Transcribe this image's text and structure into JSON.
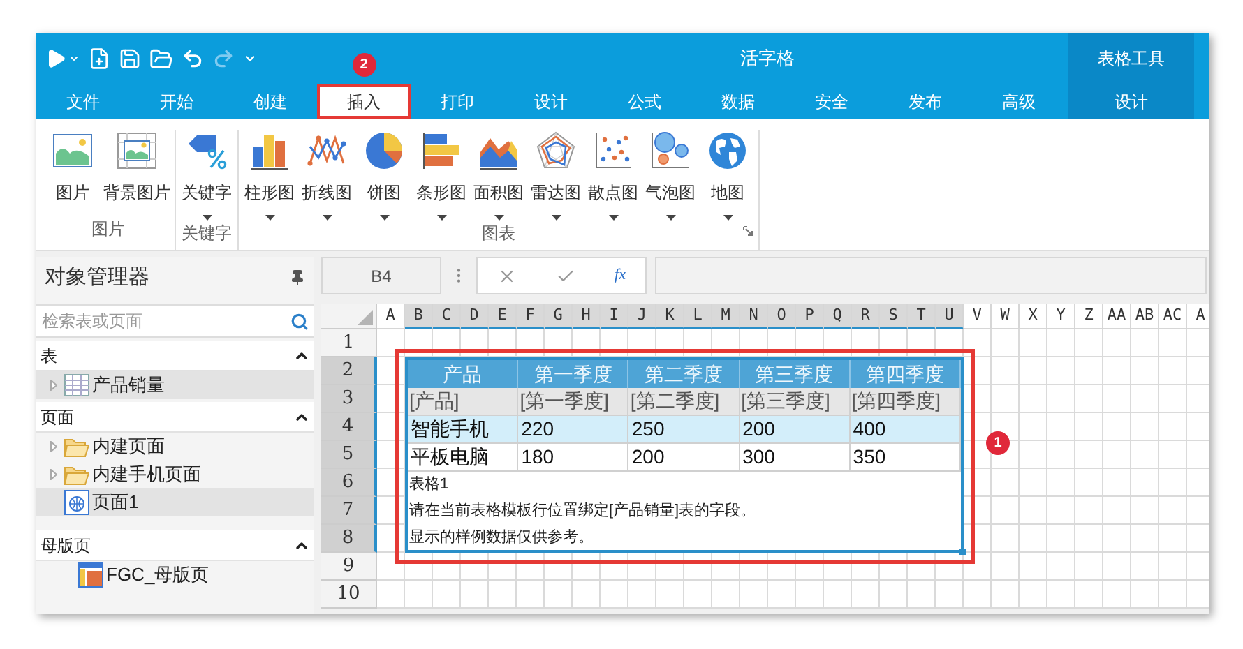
{
  "window": {
    "title": "活字格",
    "context_group": "表格工具"
  },
  "tabs": [
    {
      "label": "文件",
      "selected": false,
      "kind": "main"
    },
    {
      "label": "开始",
      "selected": false,
      "kind": "main"
    },
    {
      "label": "创建",
      "selected": false,
      "kind": "main"
    },
    {
      "label": "插入",
      "selected": true,
      "kind": "main"
    },
    {
      "label": "打印",
      "selected": false,
      "kind": "main"
    },
    {
      "label": "设计",
      "selected": false,
      "kind": "main"
    },
    {
      "label": "公式",
      "selected": false,
      "kind": "main"
    },
    {
      "label": "数据",
      "selected": false,
      "kind": "main"
    },
    {
      "label": "安全",
      "selected": false,
      "kind": "main"
    },
    {
      "label": "发布",
      "selected": false,
      "kind": "main"
    },
    {
      "label": "高级",
      "selected": false,
      "kind": "main"
    },
    {
      "label": "设计",
      "selected": false,
      "kind": "context"
    }
  ],
  "annotations": {
    "tab_marker": "2",
    "table_marker": "1"
  },
  "ribbon": {
    "groups": [
      {
        "label": "图片",
        "launcher": false,
        "buttons": [
          {
            "label": "图片",
            "kind": "picture",
            "dropdown": false
          },
          {
            "label": "背景图片",
            "kind": "background",
            "dropdown": false
          }
        ]
      },
      {
        "label": "关键字",
        "launcher": false,
        "buttons": [
          {
            "label": "关键字",
            "kind": "keyword",
            "dropdown": true
          }
        ]
      },
      {
        "label": "图表",
        "launcher": true,
        "buttons": [
          {
            "label": "柱形图",
            "kind": "column",
            "dropdown": true
          },
          {
            "label": "折线图",
            "kind": "line",
            "dropdown": true
          },
          {
            "label": "饼图",
            "kind": "pie",
            "dropdown": true
          },
          {
            "label": "条形图",
            "kind": "bar",
            "dropdown": true
          },
          {
            "label": "面积图",
            "kind": "area",
            "dropdown": true
          },
          {
            "label": "雷达图",
            "kind": "radar",
            "dropdown": true
          },
          {
            "label": "散点图",
            "kind": "scatter",
            "dropdown": true
          },
          {
            "label": "气泡图",
            "kind": "bubble",
            "dropdown": true
          },
          {
            "label": "地图",
            "kind": "map",
            "dropdown": true
          }
        ]
      }
    ]
  },
  "sidebar": {
    "title": "对象管理器",
    "search": {
      "placeholder": "检索表或页面"
    },
    "sections": [
      {
        "title": "表",
        "expanded": true,
        "items": [
          {
            "label": "产品销量",
            "kind": "table",
            "expandable": true,
            "selected": true
          }
        ]
      },
      {
        "title": "页面",
        "expanded": true,
        "items": [
          {
            "label": "内建页面",
            "kind": "folder",
            "expandable": true,
            "selected": false
          },
          {
            "label": "内建手机页面",
            "kind": "folder",
            "expandable": true,
            "selected": false
          },
          {
            "label": "页面1",
            "kind": "page",
            "expandable": false,
            "selected": true
          }
        ]
      },
      {
        "title": "母版页",
        "expanded": true,
        "items": [
          {
            "label": "FGC_母版页",
            "kind": "master",
            "expandable": false,
            "selected": false
          }
        ]
      }
    ]
  },
  "formula_bar": {
    "cell_ref": "B4",
    "function_button": "fx"
  },
  "sheet": {
    "columns": [
      {
        "label": "A",
        "selected": false
      },
      {
        "label": "B",
        "selected": true
      },
      {
        "label": "C",
        "selected": true
      },
      {
        "label": "D",
        "selected": true
      },
      {
        "label": "E",
        "selected": true
      },
      {
        "label": "F",
        "selected": true
      },
      {
        "label": "G",
        "selected": true
      },
      {
        "label": "H",
        "selected": true
      },
      {
        "label": "I",
        "selected": true
      },
      {
        "label": "J",
        "selected": true
      },
      {
        "label": "K",
        "selected": true
      },
      {
        "label": "L",
        "selected": true
      },
      {
        "label": "M",
        "selected": true
      },
      {
        "label": "N",
        "selected": true
      },
      {
        "label": "O",
        "selected": true
      },
      {
        "label": "P",
        "selected": true
      },
      {
        "label": "Q",
        "selected": true
      },
      {
        "label": "R",
        "selected": true
      },
      {
        "label": "S",
        "selected": true
      },
      {
        "label": "T",
        "selected": true
      },
      {
        "label": "U",
        "selected": true
      },
      {
        "label": "V",
        "selected": false
      },
      {
        "label": "W",
        "selected": false
      },
      {
        "label": "X",
        "selected": false
      },
      {
        "label": "Y",
        "selected": false
      },
      {
        "label": "Z",
        "selected": false
      },
      {
        "label": "AA",
        "selected": false
      },
      {
        "label": "AB",
        "selected": false
      },
      {
        "label": "AC",
        "selected": false
      },
      {
        "label": "A",
        "selected": false
      }
    ],
    "rows": [
      {
        "label": "1",
        "selected": false
      },
      {
        "label": "2",
        "selected": true
      },
      {
        "label": "3",
        "selected": true
      },
      {
        "label": "4",
        "selected": true
      },
      {
        "label": "5",
        "selected": true
      },
      {
        "label": "6",
        "selected": true
      },
      {
        "label": "7",
        "selected": true
      },
      {
        "label": "8",
        "selected": true
      },
      {
        "label": "9",
        "selected": false
      },
      {
        "label": "10",
        "selected": false
      }
    ],
    "table": {
      "header": [
        "产品",
        "第一季度",
        "第二季度",
        "第三季度",
        "第四季度"
      ],
      "template": [
        "[产品]",
        "[第一季度]",
        "[第二季度]",
        "[第三季度]",
        "[第四季度]"
      ],
      "rows": [
        {
          "cells": [
            "智能手机",
            "220",
            "250",
            "200",
            "400"
          ],
          "selected": true
        },
        {
          "cells": [
            "平板电脑",
            "180",
            "200",
            "300",
            "350"
          ],
          "selected": false
        }
      ],
      "notes": [
        "表格1",
        "请在当前表格模板行位置绑定[产品销量]表的字段。",
        "显示的样例数据仅供参考。"
      ]
    }
  }
}
